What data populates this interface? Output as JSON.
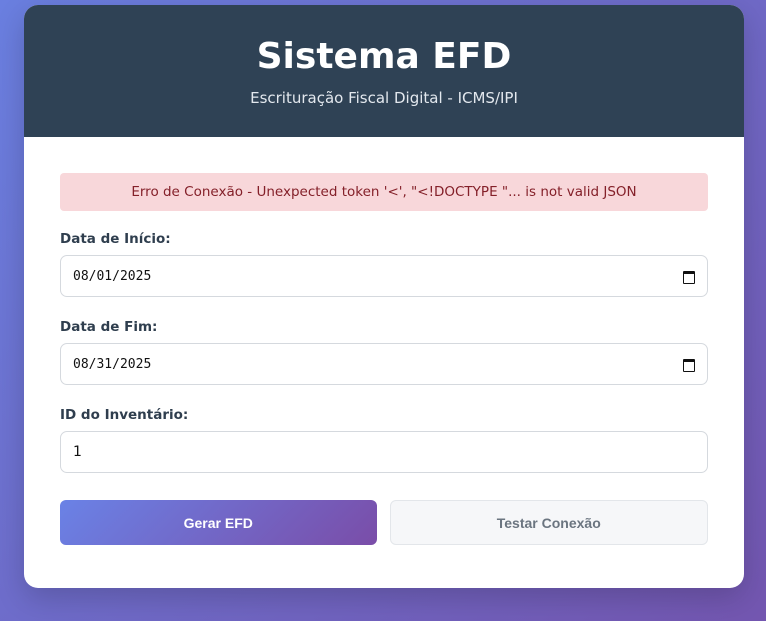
{
  "header": {
    "title": "Sistema EFD",
    "subtitle": "Escrituração Fiscal Digital - ICMS/IPI"
  },
  "alert": {
    "message": "Erro de Conexão - Unexpected token '<', \"<!DOCTYPE \"... is not valid JSON"
  },
  "form": {
    "start_date": {
      "label": "Data de Início:",
      "value": "08/01/2025"
    },
    "end_date": {
      "label": "Data de Fim:",
      "value": "08/31/2025"
    },
    "inventory_id": {
      "label": "ID do Inventário:",
      "value": "1"
    }
  },
  "actions": {
    "generate_label": "Gerar EFD",
    "test_label": "Testar Conexão"
  },
  "colors": {
    "header_bg": "#2f4255",
    "alert_bg": "#f8d7da",
    "alert_text": "#842029",
    "primary_gradient_start": "#6a82e6",
    "primary_gradient_end": "#7a4da8"
  },
  "icons": {
    "calendar": "calendar-icon"
  }
}
